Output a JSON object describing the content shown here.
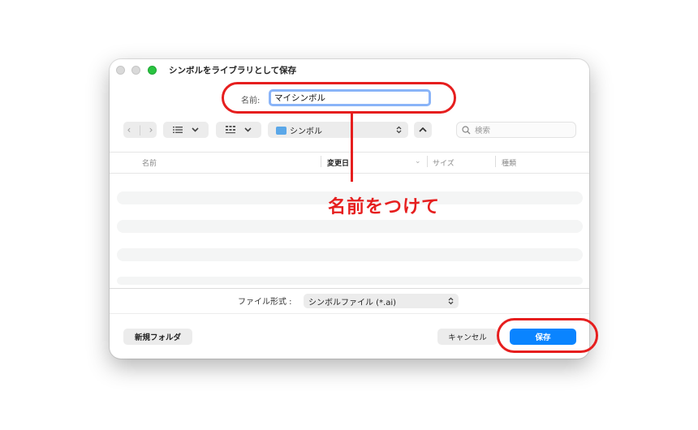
{
  "window": {
    "title": "シンボルをライブラリとして保存"
  },
  "name_field": {
    "label": "名前:",
    "value": "マイシンボル"
  },
  "toolbar": {
    "location": "シンボル",
    "search_placeholder": "検索"
  },
  "columns": {
    "name": "名前",
    "date": "変更日",
    "size": "サイズ",
    "kind": "種類"
  },
  "format": {
    "label": "ファイル形式 :",
    "value": "シンボルファイル (*.ai)"
  },
  "buttons": {
    "new_folder": "新規フォルダ",
    "cancel": "キャンセル",
    "save": "保存"
  },
  "annotation": {
    "text": "名前をつけて",
    "color": "#e61e1e"
  },
  "colors": {
    "accent": "#0a84ff",
    "focus_ring": "#8ab4f8"
  }
}
